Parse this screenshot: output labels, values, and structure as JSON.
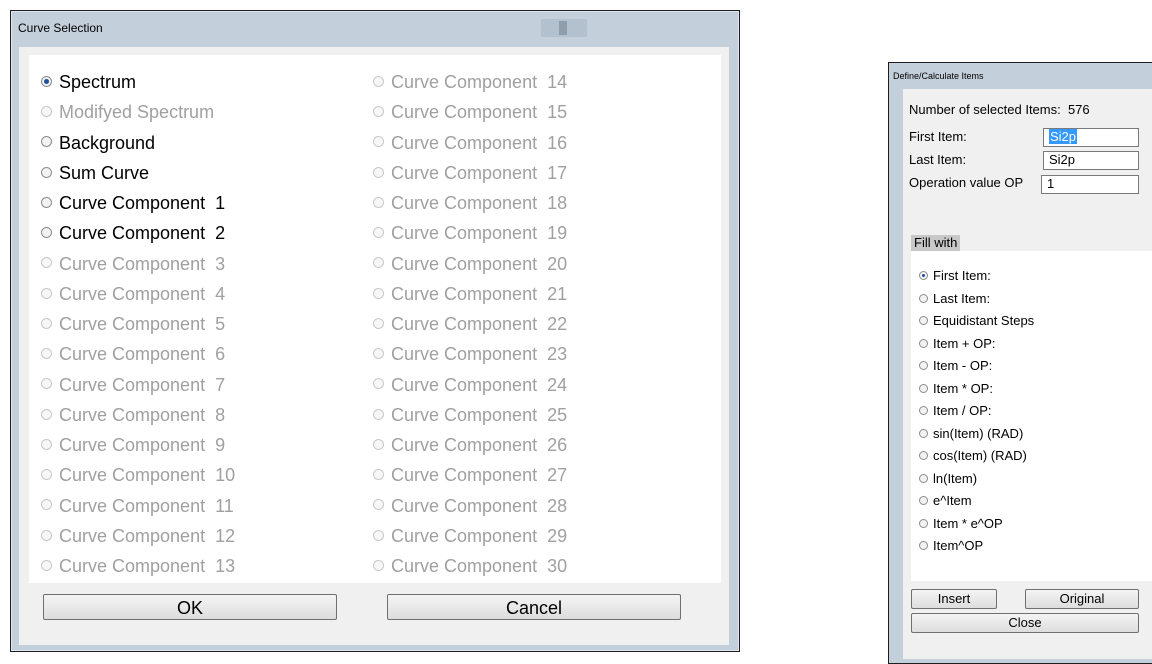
{
  "curve_selection": {
    "title": "Curve Selection",
    "column_left": [
      {
        "label": "Spectrum",
        "enabled": true,
        "selected": true
      },
      {
        "label": "Modifyed Spectrum",
        "enabled": false,
        "selected": false
      },
      {
        "label": "Background",
        "enabled": true,
        "selected": false
      },
      {
        "label": "Sum Curve",
        "enabled": true,
        "selected": false
      },
      {
        "label": "Curve Component  1",
        "enabled": true,
        "selected": false
      },
      {
        "label": "Curve Component  2",
        "enabled": true,
        "selected": false
      },
      {
        "label": "Curve Component  3",
        "enabled": false,
        "selected": false
      },
      {
        "label": "Curve Component  4",
        "enabled": false,
        "selected": false
      },
      {
        "label": "Curve Component  5",
        "enabled": false,
        "selected": false
      },
      {
        "label": "Curve Component  6",
        "enabled": false,
        "selected": false
      },
      {
        "label": "Curve Component  7",
        "enabled": false,
        "selected": false
      },
      {
        "label": "Curve Component  8",
        "enabled": false,
        "selected": false
      },
      {
        "label": "Curve Component  9",
        "enabled": false,
        "selected": false
      },
      {
        "label": "Curve Component  10",
        "enabled": false,
        "selected": false
      },
      {
        "label": "Curve Component  11",
        "enabled": false,
        "selected": false
      },
      {
        "label": "Curve Component  12",
        "enabled": false,
        "selected": false
      },
      {
        "label": "Curve Component  13",
        "enabled": false,
        "selected": false
      }
    ],
    "column_right": [
      {
        "label": "Curve Component  14",
        "enabled": false,
        "selected": false
      },
      {
        "label": "Curve Component  15",
        "enabled": false,
        "selected": false
      },
      {
        "label": "Curve Component  16",
        "enabled": false,
        "selected": false
      },
      {
        "label": "Curve Component  17",
        "enabled": false,
        "selected": false
      },
      {
        "label": "Curve Component  18",
        "enabled": false,
        "selected": false
      },
      {
        "label": "Curve Component  19",
        "enabled": false,
        "selected": false
      },
      {
        "label": "Curve Component  20",
        "enabled": false,
        "selected": false
      },
      {
        "label": "Curve Component  21",
        "enabled": false,
        "selected": false
      },
      {
        "label": "Curve Component  22",
        "enabled": false,
        "selected": false
      },
      {
        "label": "Curve Component  23",
        "enabled": false,
        "selected": false
      },
      {
        "label": "Curve Component  24",
        "enabled": false,
        "selected": false
      },
      {
        "label": "Curve Component  25",
        "enabled": false,
        "selected": false
      },
      {
        "label": "Curve Component  26",
        "enabled": false,
        "selected": false
      },
      {
        "label": "Curve Component  27",
        "enabled": false,
        "selected": false
      },
      {
        "label": "Curve Component  28",
        "enabled": false,
        "selected": false
      },
      {
        "label": "Curve Component  29",
        "enabled": false,
        "selected": false
      },
      {
        "label": "Curve Component  30",
        "enabled": false,
        "selected": false
      }
    ],
    "ok_label": "OK",
    "cancel_label": "Cancel"
  },
  "define_items": {
    "title": "Define/Calculate Items",
    "selected_count_label": "Number of selected Items:  576",
    "first_item_label": "First Item:",
    "first_item_value": "Si2p",
    "last_item_label": "Last Item:",
    "last_item_value": "Si2p",
    "op_label": "Operation value OP",
    "op_value": "1",
    "fill_with_label": "Fill with",
    "fill_options": [
      {
        "label": "First Item:",
        "selected": true
      },
      {
        "label": "Last Item:",
        "selected": false
      },
      {
        "label": "Equidistant Steps",
        "selected": false
      },
      {
        "label": "Item + OP:",
        "selected": false
      },
      {
        "label": "Item - OP:",
        "selected": false
      },
      {
        "label": "Item * OP:",
        "selected": false
      },
      {
        "label": "Item / OP:",
        "selected": false
      },
      {
        "label": "sin(Item) (RAD)",
        "selected": false
      },
      {
        "label": "cos(Item) (RAD)",
        "selected": false
      },
      {
        "label": "ln(Item)",
        "selected": false
      },
      {
        "label": "e^Item",
        "selected": false
      },
      {
        "label": "Item * e^OP",
        "selected": false
      },
      {
        "label": "Item^OP",
        "selected": false
      }
    ],
    "insert_label": "Insert",
    "original_label": "Original",
    "close_label": "Close"
  }
}
